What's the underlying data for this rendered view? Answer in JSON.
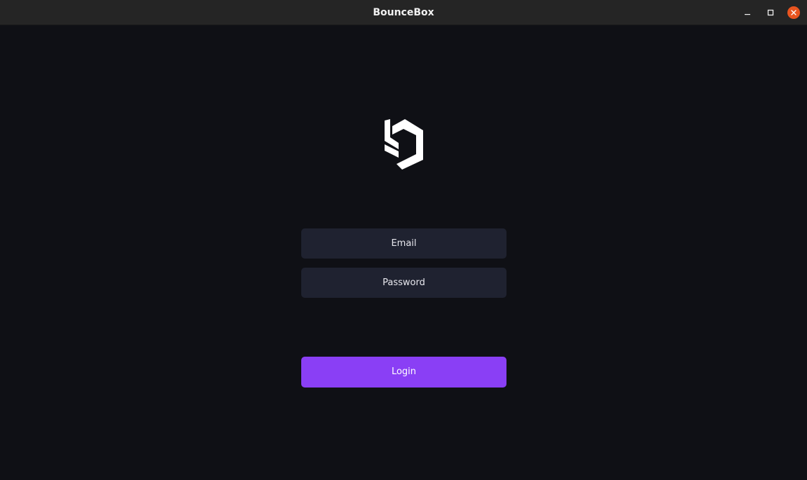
{
  "window": {
    "title": "BounceBox"
  },
  "login": {
    "email_placeholder": "Email",
    "password_placeholder": "Password",
    "login_label": "Login"
  },
  "icons": {
    "logo": "bouncebox-logo",
    "minimize": "minimize-icon",
    "maximize": "maximize-icon",
    "close": "close-icon"
  },
  "colors": {
    "background": "#0f1015",
    "titlebar": "#252525",
    "field": "#1f2230",
    "accent": "#8a3ff5",
    "close_button": "#e9541f"
  }
}
